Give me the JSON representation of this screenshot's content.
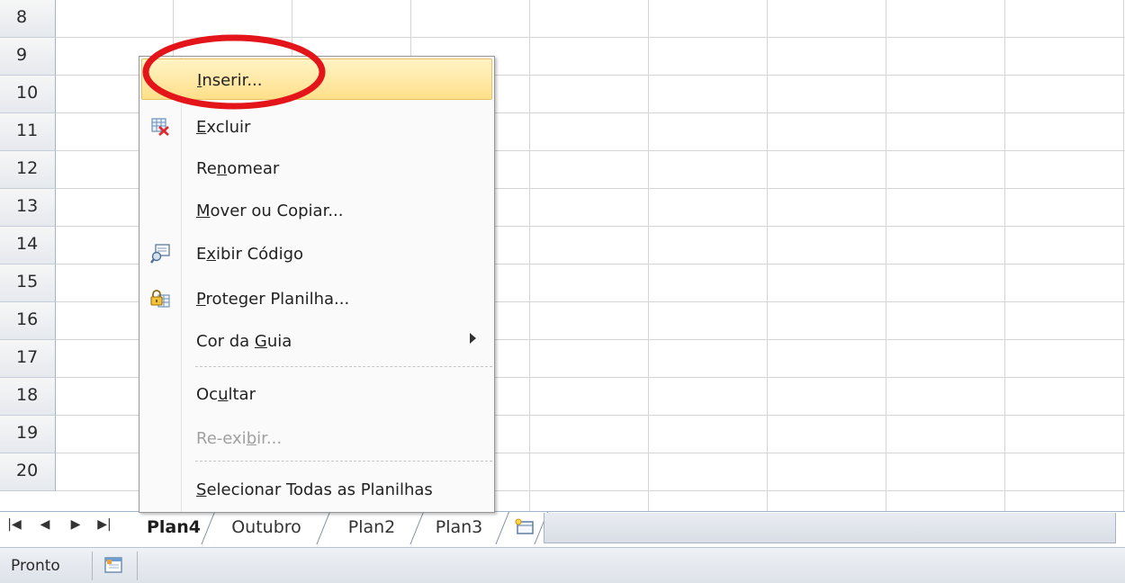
{
  "grid": {
    "row_numbers": [
      "8",
      "9",
      "10",
      "11",
      "12",
      "13",
      "14",
      "15",
      "16",
      "17",
      "18",
      "19",
      "20"
    ]
  },
  "context_menu": {
    "items": [
      {
        "pre": "",
        "key": "I",
        "post": "nserir...",
        "icon": "",
        "disabled": false,
        "highlighted": true
      },
      {
        "pre": "",
        "key": "E",
        "post": "xcluir",
        "icon": "delete-sheet-icon",
        "disabled": false,
        "highlighted": false
      },
      {
        "pre": "Re",
        "key": "n",
        "post": "omear",
        "icon": "",
        "disabled": false,
        "highlighted": false
      },
      {
        "pre": "",
        "key": "M",
        "post": "over ou Copiar...",
        "icon": "",
        "disabled": false,
        "highlighted": false
      },
      {
        "pre": "E",
        "key": "x",
        "post": "ibir Código",
        "icon": "view-code-icon",
        "disabled": false,
        "highlighted": false
      },
      {
        "pre": "",
        "key": "P",
        "post": "roteger Planilha...",
        "icon": "protect-sheet-icon",
        "disabled": false,
        "highlighted": false
      },
      {
        "pre": "Cor da ",
        "key": "G",
        "post": "uia",
        "icon": "",
        "disabled": false,
        "highlighted": false,
        "submenu": true
      },
      {
        "pre": "Oc",
        "key": "u",
        "post": "ltar",
        "icon": "",
        "disabled": false,
        "highlighted": false
      },
      {
        "pre": "Re-exi",
        "key": "b",
        "post": "ir...",
        "icon": "",
        "disabled": true,
        "highlighted": false
      },
      {
        "pre": "",
        "key": "S",
        "post": "elecionar Todas as Planilhas",
        "icon": "",
        "disabled": false,
        "highlighted": false
      }
    ]
  },
  "sheet_tabs": {
    "tabs": [
      "Plan4",
      "Outubro",
      "Plan2",
      "Plan3"
    ],
    "active": "Plan4"
  },
  "status_bar": {
    "status": "Pronto"
  },
  "colors": {
    "annotation": "#e3151a",
    "menu_highlight": "#ffe08a"
  }
}
